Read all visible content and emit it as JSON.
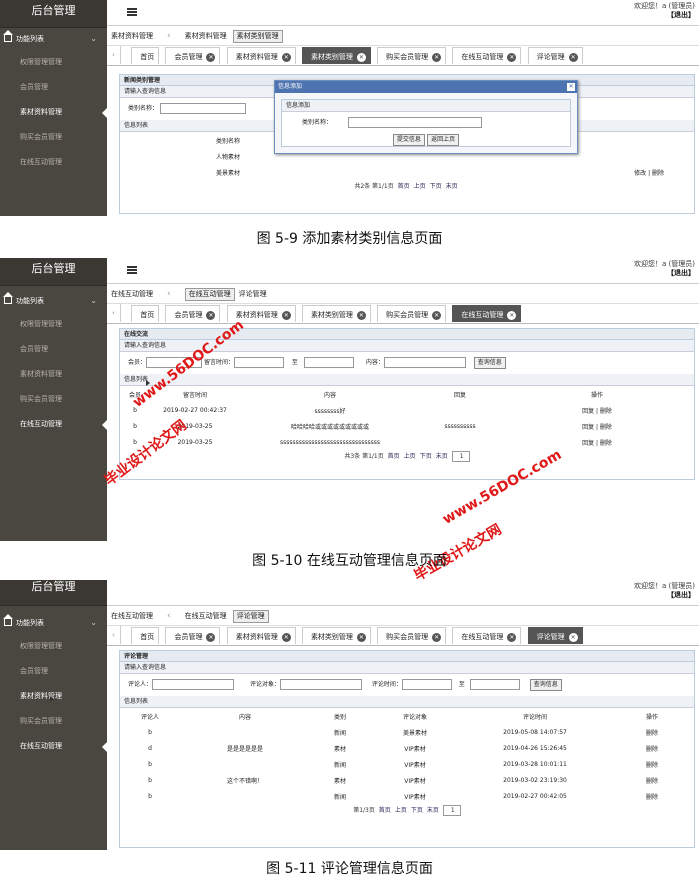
{
  "common": {
    "app_title": "后台管理",
    "group": "功能列表",
    "welcome_line1": "欢迎您！a (管理员)",
    "welcome_line2": "【退出】",
    "nav": [
      "权限管理管理",
      "会员管理",
      "素材资料管理",
      "购买会员管理",
      "在线互动管理"
    ]
  },
  "fig1": {
    "crumbs": [
      "素材资料管理",
      "素材资料管理",
      "素材类别管理"
    ],
    "tabs": [
      "首页",
      "会员管理",
      "素材资料管理",
      "素材类别管理",
      "购买会员管理",
      "在线互动管理",
      "评论管理"
    ],
    "panel_title": "新闻类别管理",
    "search_title": "请输入查询信息",
    "search_label": "类别名称：",
    "list_title": "信息列表",
    "col": "类别名称",
    "rows": [
      {
        "name": "人物素材",
        "actions": ""
      },
      {
        "name": "美景素材",
        "actions": "修改 | 删除"
      }
    ],
    "pager": [
      "共2条 第1/1页",
      "首页",
      "上页",
      "下页",
      "末页"
    ],
    "modal": {
      "title": "信息添加",
      "section": "信息添加",
      "label": "类别名称：",
      "submit": "提交信息",
      "back": "返回上页"
    },
    "caption": "图 5-9 添加素材类别信息页面"
  },
  "fig2": {
    "crumbs": [
      "在线互动管理",
      "在线互动管理",
      "评论管理"
    ],
    "tabs": [
      "首页",
      "会员管理",
      "素材资料管理",
      "素材类别管理",
      "购买会员管理",
      "在线互动管理"
    ],
    "panel_title": "在线交流",
    "search_title": "请输入查询信息",
    "f_member": "会员：",
    "f_time": "留言时间：",
    "f_to": "至",
    "f_content": "内容：",
    "search_btn": "查询信息",
    "list_title": "信息列表",
    "cols": [
      "会员",
      "留言时间",
      "内容",
      "回复",
      "操作"
    ],
    "rows": [
      {
        "member": "b",
        "time": "2019-02-27 00:42:37",
        "content": "ssssssss好",
        "reply": "",
        "ops": "回复 | 删除"
      },
      {
        "member": "b",
        "time": "2019-03-25",
        "content": "哈哈哈哈或或或或或或或或或",
        "reply": "ssssssssss",
        "ops": "回复 | 删除"
      },
      {
        "member": "b",
        "time": "2019-03-25",
        "content": "ssssssssssssssssssssssssssssssss",
        "reply": "",
        "ops": "回复 | 删除"
      }
    ],
    "pager": [
      "共3条 第1/1页",
      "首页",
      "上页",
      "下页",
      "末页"
    ],
    "page_select": "1",
    "caption": "图 5-10 在线互动管理信息页面",
    "watermarks": [
      "www.56DOC.com",
      "毕业设计论文网",
      "www.56DOC.com",
      "毕业设计论文网"
    ]
  },
  "fig3": {
    "crumbs": [
      "在线互动管理",
      "在线互动管理",
      "评论管理"
    ],
    "tabs": [
      "首页",
      "会员管理",
      "素材资料管理",
      "素材类别管理",
      "购买会员管理",
      "在线互动管理",
      "评论管理"
    ],
    "panel_title": "评论管理",
    "search_title": "请输入查询信息",
    "f_person": "评论人：",
    "f_obj": "评论对象：",
    "f_time": "评论时间：",
    "f_to": "至",
    "search_btn": "查询信息",
    "list_title": "信息列表",
    "cols": [
      "评论人",
      "内容",
      "类别",
      "评论对象",
      "评论时间",
      "操作"
    ],
    "rows": [
      {
        "p": "b",
        "c": "",
        "t": "新闻",
        "o": "美景素材",
        "time": "2019-05-08 14:07:57",
        "op": "删除"
      },
      {
        "p": "d",
        "c": "是是是是是是",
        "t": "素材",
        "o": "VIP素材",
        "time": "2019-04-26 15:26:45",
        "op": "删除"
      },
      {
        "p": "b",
        "c": "",
        "t": "新闻",
        "o": "VIP素材",
        "time": "2019-03-28 10:01:11",
        "op": "删除"
      },
      {
        "p": "b",
        "c": "这个不错啊！",
        "t": "素材",
        "o": "VIP素材",
        "time": "2019-03-02 23:19:30",
        "op": "删除"
      },
      {
        "p": "b",
        "c": "",
        "t": "新闻",
        "o": "VIP素材",
        "time": "2019-02-27 00:42:05",
        "op": "删除"
      }
    ],
    "pager": [
      "第1/3页",
      "首页",
      "上页",
      "下页",
      "末页"
    ],
    "page_select": "1",
    "caption": "图 5-11 评论管理信息页面"
  }
}
